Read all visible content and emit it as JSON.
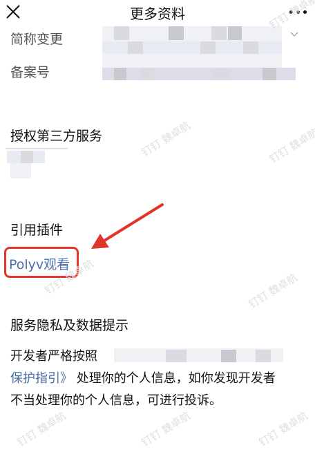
{
  "header": {
    "title": "更多资料"
  },
  "rows": {
    "alias_label": "简称变更",
    "record_label": "备案号"
  },
  "sections": {
    "third_party": "授权第三方服务",
    "plugins": "引用插件",
    "privacy": "服务隐私及数据提示"
  },
  "plugin": {
    "name": "Polyv观看"
  },
  "privacy_text": {
    "line1_start": "开发者严格按照",
    "link": "保护指引》",
    "rest": " 处理你的个人信息，如你发现开发",
    "rest2": "者",
    "line3": "不当处理你的个人信息，可进行投诉。"
  },
  "watermark": "钉钉 魏卓航",
  "colors": {
    "link": "#4a6fa8",
    "highlight": "#e0352b"
  }
}
